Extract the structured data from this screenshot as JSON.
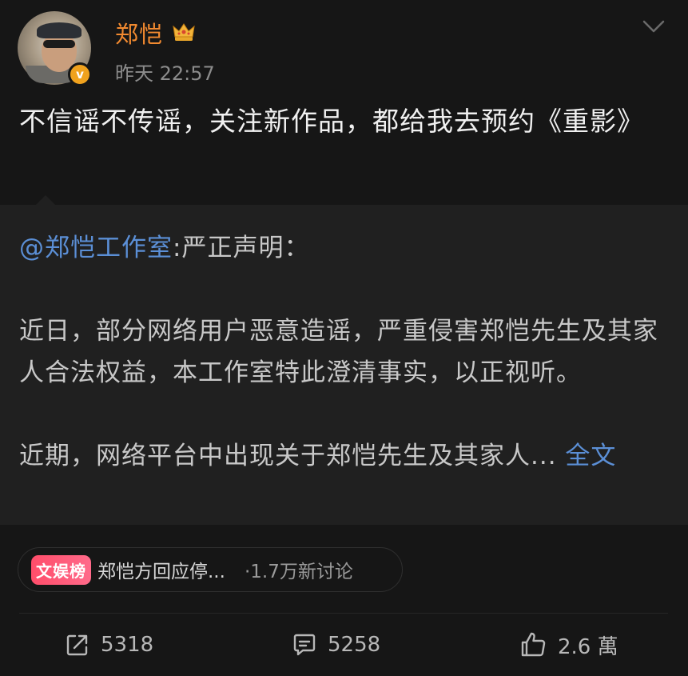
{
  "author": {
    "name": "郑恺",
    "timestamp": "昨天 22:57",
    "verified_icon": "verified-badge-icon",
    "badge_icon": "crown-icon"
  },
  "post": {
    "text": "不信谣不传谣，关注新作品，都给我去预约《重影》"
  },
  "repost": {
    "mention": "@郑恺工作室",
    "lead": ":严正声明：",
    "para1": "近日，部分网络用户恶意造谣，严重侵害郑恺先生及其家人合法权益，本工作室特此澄清事实，以正视听。",
    "para2": "近期，网络平台中出现关于郑恺先生及其家人...",
    "full_text_link": "全文"
  },
  "topic": {
    "badge": "文娱榜",
    "title": "郑恺方回应停...",
    "count": "·1.7万新讨论"
  },
  "actions": {
    "share_count": "5318",
    "comment_count": "5258",
    "like_count": "2.6 萬"
  },
  "colors": {
    "background": "#161616",
    "repost_background": "#202020",
    "username": "#f28a30",
    "link": "#5b8fd6",
    "topic_badge": "#ff4d6a"
  }
}
